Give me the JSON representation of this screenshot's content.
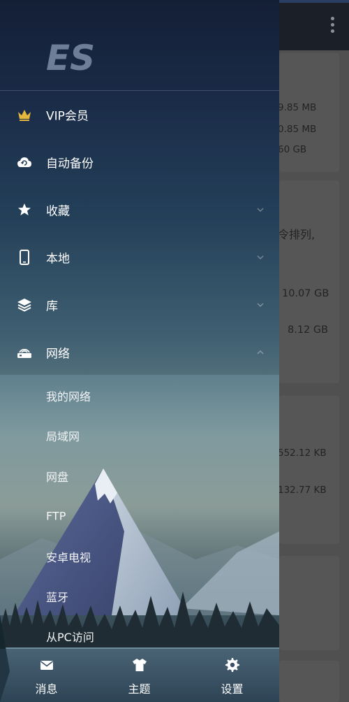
{
  "background_app": {
    "sizes": [
      "9.85 MB",
      "0.85 MB",
      "60 GB",
      "10.07 GB",
      "8.12 GB",
      "552.12 KB",
      "132.77 KB"
    ],
    "sort_text": "令排列,"
  },
  "drawer": {
    "logo_text": "ES",
    "menu": [
      {
        "label": "VIP会员",
        "icon": "crown-icon"
      },
      {
        "label": "自动备份",
        "icon": "cloud-backup-icon"
      },
      {
        "label": "收藏",
        "icon": "star-icon"
      },
      {
        "label": "本地",
        "icon": "phone-icon"
      },
      {
        "label": "库",
        "icon": "layers-icon"
      },
      {
        "label": "网络",
        "icon": "router-icon"
      }
    ],
    "network_items": [
      "我的网络",
      "局域网",
      "网盘",
      "FTP",
      "安卓电视",
      "蓝牙",
      "从PC访问"
    ]
  },
  "bottom_tabs": [
    {
      "label": "消息",
      "icon": "mail-icon"
    },
    {
      "label": "主题",
      "icon": "shirt-icon"
    },
    {
      "label": "设置",
      "icon": "gear-icon"
    }
  ],
  "colors": {
    "crown": "#e6b83c",
    "drawer_top": "#15203a",
    "text": "#ffffff"
  }
}
